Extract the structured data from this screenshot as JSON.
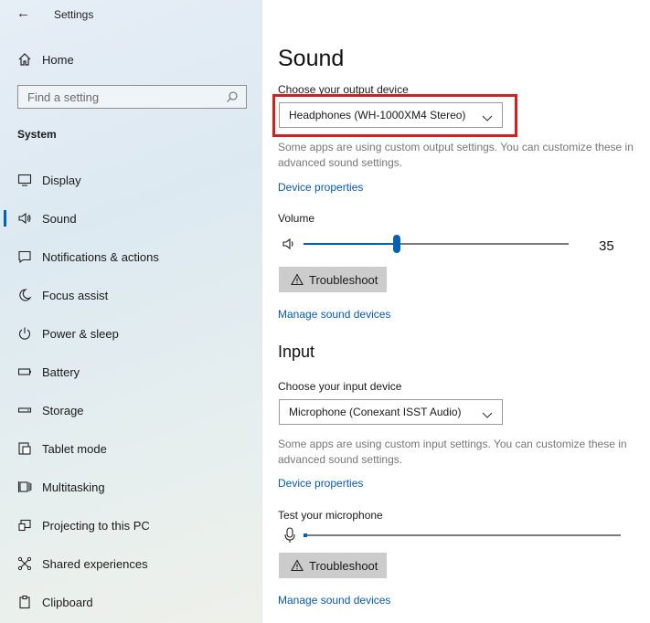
{
  "window": {
    "title": "Settings"
  },
  "sidebar": {
    "home_label": "Home",
    "search_placeholder": "Find a setting",
    "section_title": "System",
    "items": [
      {
        "label": "Display",
        "icon": "monitor-icon",
        "active": false
      },
      {
        "label": "Sound",
        "icon": "speaker-icon",
        "active": true
      },
      {
        "label": "Notifications & actions",
        "icon": "notification-icon",
        "active": false
      },
      {
        "label": "Focus assist",
        "icon": "moon-icon",
        "active": false
      },
      {
        "label": "Power & sleep",
        "icon": "power-icon",
        "active": false
      },
      {
        "label": "Battery",
        "icon": "battery-icon",
        "active": false
      },
      {
        "label": "Storage",
        "icon": "storage-icon",
        "active": false
      },
      {
        "label": "Tablet mode",
        "icon": "tablet-icon",
        "active": false
      },
      {
        "label": "Multitasking",
        "icon": "multitasking-icon",
        "active": false
      },
      {
        "label": "Projecting to this PC",
        "icon": "projector-icon",
        "active": false
      },
      {
        "label": "Shared experiences",
        "icon": "shared-icon",
        "active": false
      },
      {
        "label": "Clipboard",
        "icon": "clipboard-icon",
        "active": false
      }
    ]
  },
  "main": {
    "title": "Sound",
    "output": {
      "label": "Choose your output device",
      "selected": "Headphones (WH-1000XM4 Stereo)",
      "note": "Some apps are using custom output settings. You can customize these in advanced sound settings.",
      "device_properties": "Device properties",
      "volume_label": "Volume",
      "volume_value": "35",
      "volume_fraction": 0.35,
      "troubleshoot": "Troubleshoot",
      "manage": "Manage sound devices"
    },
    "input": {
      "heading": "Input",
      "label": "Choose your input device",
      "selected": "Microphone (Conexant ISST Audio)",
      "note": "Some apps are using custom input settings. You can customize these in advanced sound settings.",
      "device_properties": "Device properties",
      "test_label": "Test your microphone",
      "troubleshoot": "Troubleshoot",
      "manage": "Manage sound devices"
    }
  },
  "colors": {
    "accent": "#0063b1",
    "link": "#0a5aad",
    "highlight": "#d51e1e"
  }
}
